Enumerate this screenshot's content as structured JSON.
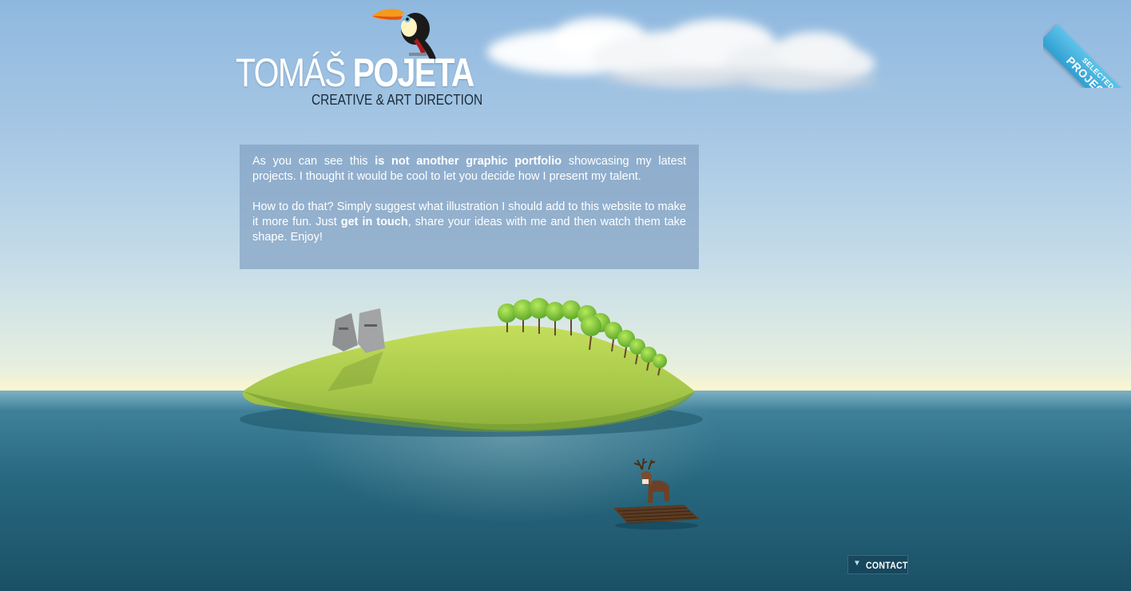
{
  "logo": {
    "first_name": "TOMÁŠ",
    "last_name": "POJETA",
    "tagline": "CREATIVE & ART DIRECTION"
  },
  "ribbon": {
    "line1": "SELECTED",
    "line2": "PROJECTS",
    "color": "#3aa9d8"
  },
  "intro": {
    "p1_pre": "As you can see this ",
    "p1_bold": "is not another graphic portfolio",
    "p1_post": " showcasing my latest projects. I thought it would be cool to let you decide how I present my talent.",
    "p2_pre": "How to do that? Simply suggest what illustration I should add to this website to make it more fun. Just ",
    "p2_bold": "get in touch",
    "p2_post": ", share your ideas with me and then watch them take shape. Enjoy!"
  },
  "contact": {
    "label": "CONTACT",
    "icon": "chevron-down-icon"
  },
  "colors": {
    "sky_top": "#8fb8df",
    "horizon": "#fbf6cf",
    "sea": "#27687f",
    "island": "#a9cc45"
  }
}
